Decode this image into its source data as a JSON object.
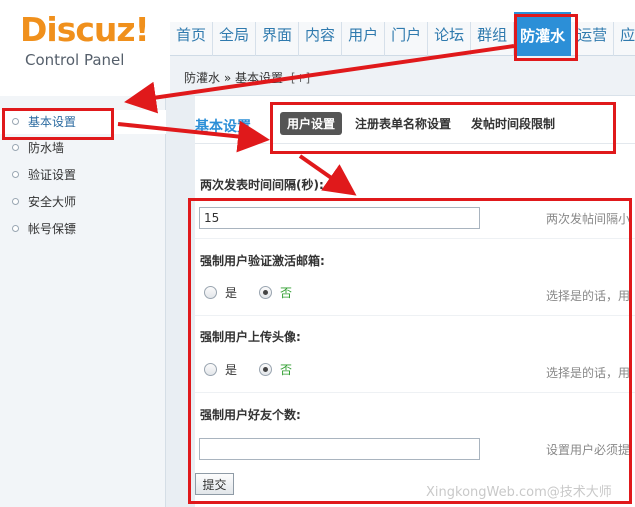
{
  "logo": {
    "main": "Discuz!",
    "sub": "Control Panel"
  },
  "topnav": [
    "首页",
    "全局",
    "界面",
    "内容",
    "用户",
    "门户",
    "论坛",
    "群组",
    "防灌水",
    "运营",
    "应"
  ],
  "breadcrumb": {
    "path": "防灌水 » 基本设置",
    "plus": "[+]"
  },
  "sidebar": {
    "items": [
      "基本设置",
      "防水墙",
      "验证设置",
      "安全大师",
      "帐号保镖"
    ]
  },
  "main": {
    "section_title": "基本设置",
    "subtabs": [
      "用户设置",
      "注册表单名称设置",
      "发帖时间段限制"
    ],
    "fields": [
      {
        "label": "两次发表时间间隔(秒):",
        "value": "15",
        "tip": "两次发帖间隔小"
      },
      {
        "label": "强制用户验证激活邮箱:",
        "opt_yes": "是",
        "opt_no": "否",
        "tip": "选择是的话，用"
      },
      {
        "label": "强制用户上传头像:",
        "opt_yes": "是",
        "opt_no": "否",
        "tip": "选择是的话，用"
      },
      {
        "label": "强制用户好友个数:",
        "value": "",
        "tip": "设置用户必须提"
      }
    ],
    "submit": "提交"
  },
  "watermark": "XingkongWeb.com@技术大师",
  "colors": {
    "accent": "#2c8fd7",
    "annotation": "#e0191b",
    "logo": "#f0901c",
    "option_selected": "#2f9e2f"
  }
}
